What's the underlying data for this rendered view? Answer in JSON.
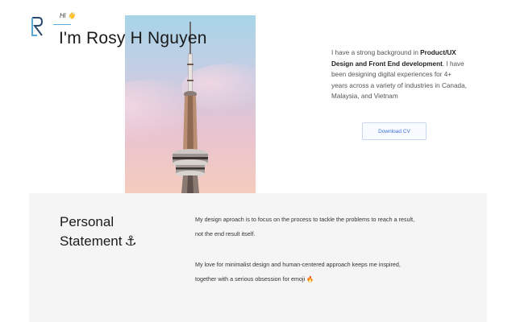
{
  "header": {
    "greeting": "Hi",
    "greeting_emoji": "👋",
    "name_heading": "I'm Rosy H Nguyen"
  },
  "bio": {
    "part1": "I have a strong background in ",
    "bold": "Product/UX Design and Front End development",
    "part2": ". I have been designing digital experiences for 4+ years across a variety of industries in Canada, Malaysia, and Vietnam"
  },
  "download_button": {
    "label": "Download CV"
  },
  "personal_statement": {
    "title_line1": "Personal",
    "title_line2": "Statement",
    "title_icon": "⚓",
    "paragraph1": "My design aproach is to focus on the process to tackle the problems to reach a result, not the end result itself.",
    "paragraph2": "My love for minimalist design and human-centered approach keeps me inspired, together with a serious obsession for emoji",
    "paragraph2_emoji": "🔥"
  },
  "colors": {
    "accent": "#5aa9d6",
    "button_text": "#3b6fd4",
    "section_bg": "#f5f5f5"
  },
  "icons": {
    "logo": "r-letter-logo",
    "photo": "cn-tower-photo"
  }
}
